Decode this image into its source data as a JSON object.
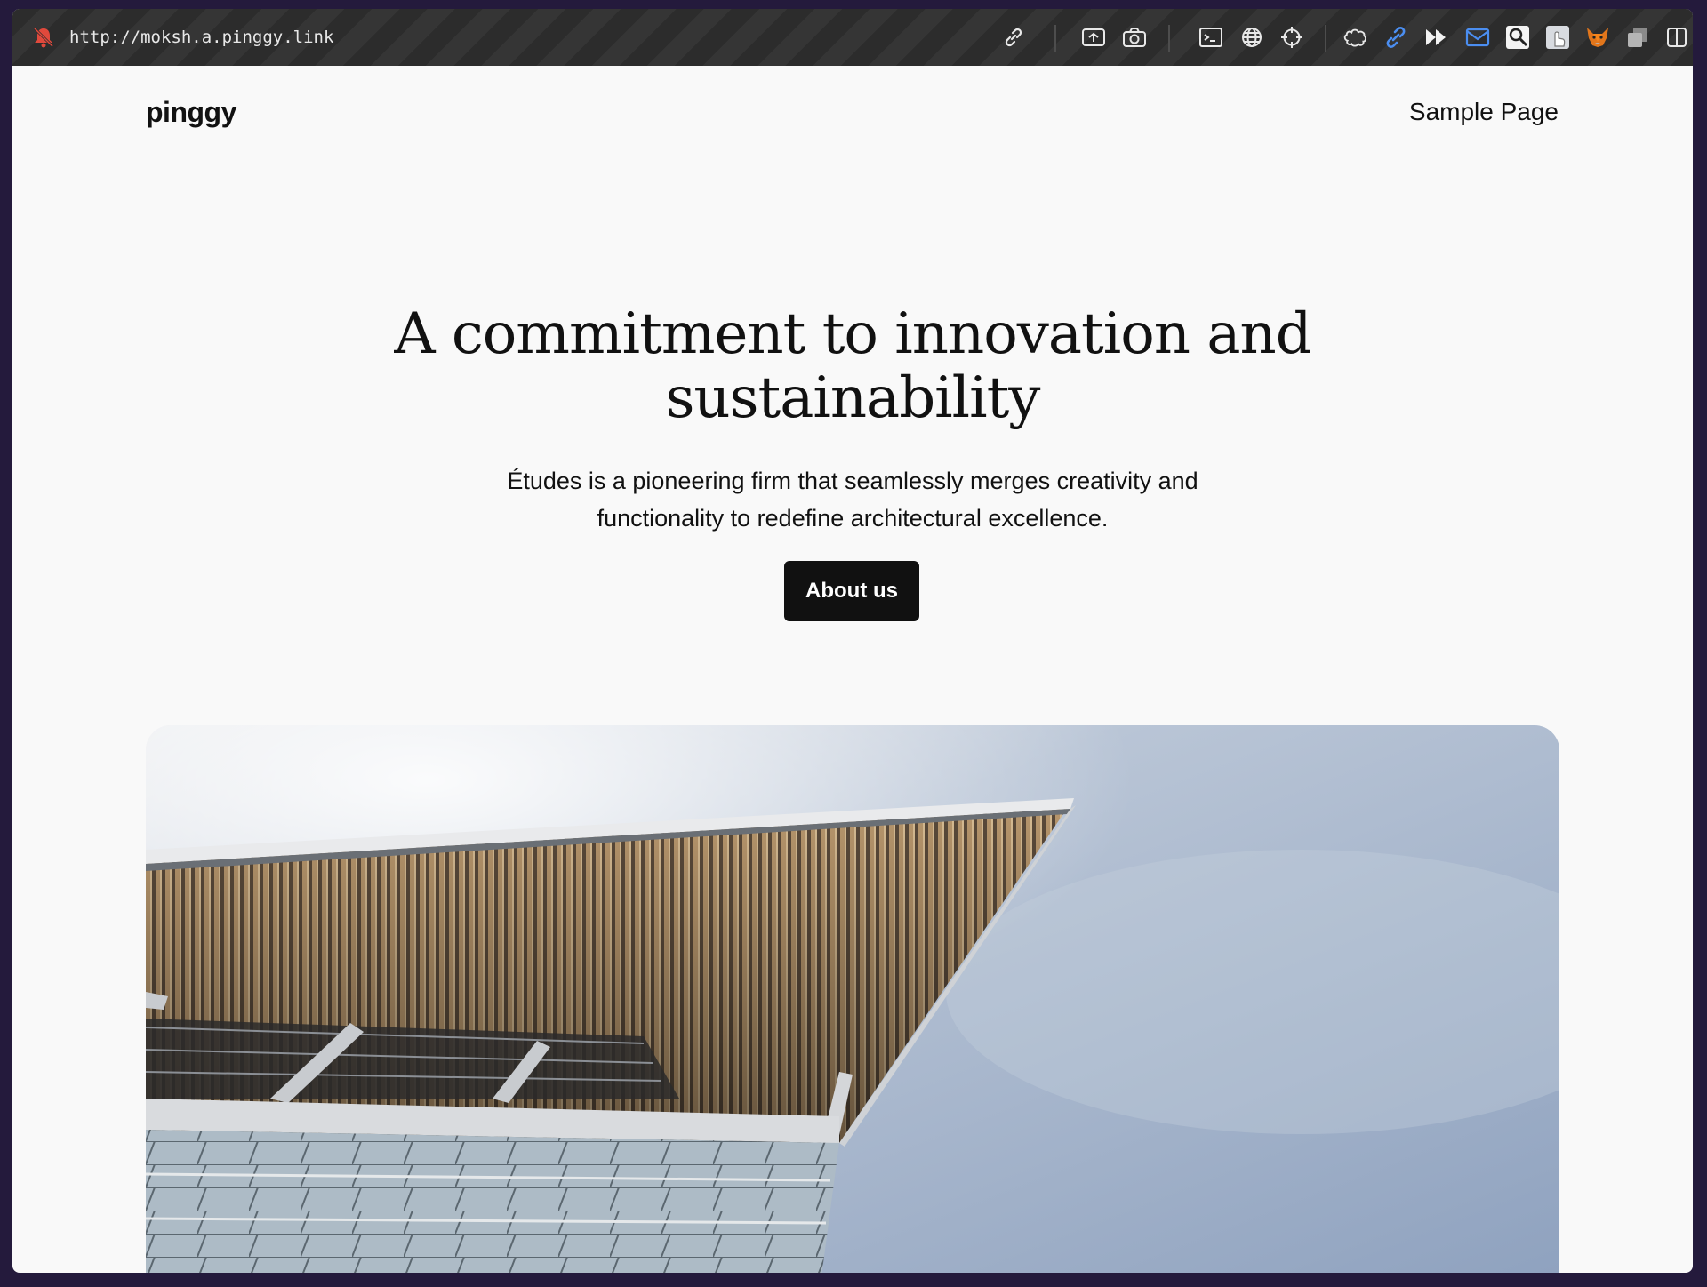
{
  "browser": {
    "url": "http://moksh.a.pinggy.link",
    "toolbar_icons": [
      "link-icon",
      "screenshot-region-icon",
      "camera-icon",
      "terminal-icon",
      "globe-icon",
      "crosshair-icon",
      "puzzle-icon",
      "link-blue-icon",
      "fast-forward-icon",
      "mail-icon",
      "zoom-icon",
      "touch-icon",
      "fox-icon",
      "copy-icon",
      "sidebar-icon"
    ]
  },
  "site": {
    "title": "pinggy",
    "nav": [
      {
        "label": "Sample Page"
      }
    ]
  },
  "hero": {
    "heading_line1": "A commitment to innovation and",
    "heading_line2": "sustainability",
    "subtitle_line1": "Études is a pioneering firm that seamlessly merges creativity and",
    "subtitle_line2": "functionality to redefine architectural excellence.",
    "button_label": "About us"
  },
  "colors": {
    "toolbar": "#2c2c2c",
    "page_bg": "#f9f9f9",
    "button_bg": "#111111",
    "sky": "#a9b8cf"
  }
}
